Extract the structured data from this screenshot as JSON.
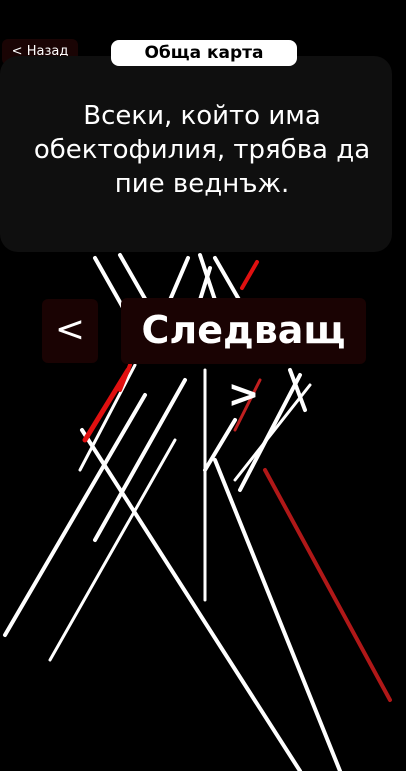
{
  "header": {
    "back_label": "< Назад",
    "category": "Обща карта"
  },
  "card": {
    "text": "Всеки, който има обектофилия, трябва да пие веднъж."
  },
  "navigation": {
    "prev_label": "<",
    "next_label": "Следващ >"
  },
  "colors": {
    "background": "#000000",
    "accent": "#e01010",
    "button_bg": "#1a0303",
    "card_bg": "#0f0f0f"
  }
}
